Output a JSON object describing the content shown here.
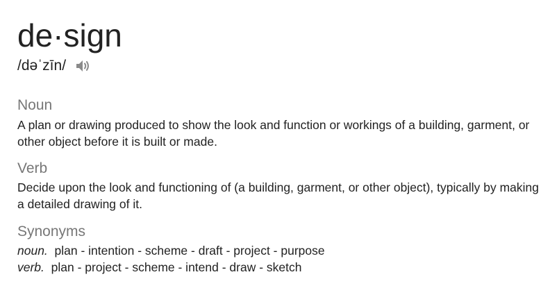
{
  "entry": {
    "headword": "de·sign",
    "pronunciation": "/dəˈzīn/",
    "audio_icon": "speaker-icon"
  },
  "noun": {
    "label": "Noun",
    "definition": "A plan or drawing produced to show the look and function or workings of a building, garment, or other object before it is built or made."
  },
  "verb": {
    "label": "Verb",
    "definition": "Decide upon the look and functioning of (a building, garment, or other object), typically by making a detailed drawing of it."
  },
  "synonyms": {
    "label": "Synonyms",
    "noun_pos": "noun.",
    "noun_list": "plan - intention - scheme - draft - project - purpose",
    "verb_pos": "verb.",
    "verb_list": "plan - project - scheme - intend - draw - sketch"
  }
}
